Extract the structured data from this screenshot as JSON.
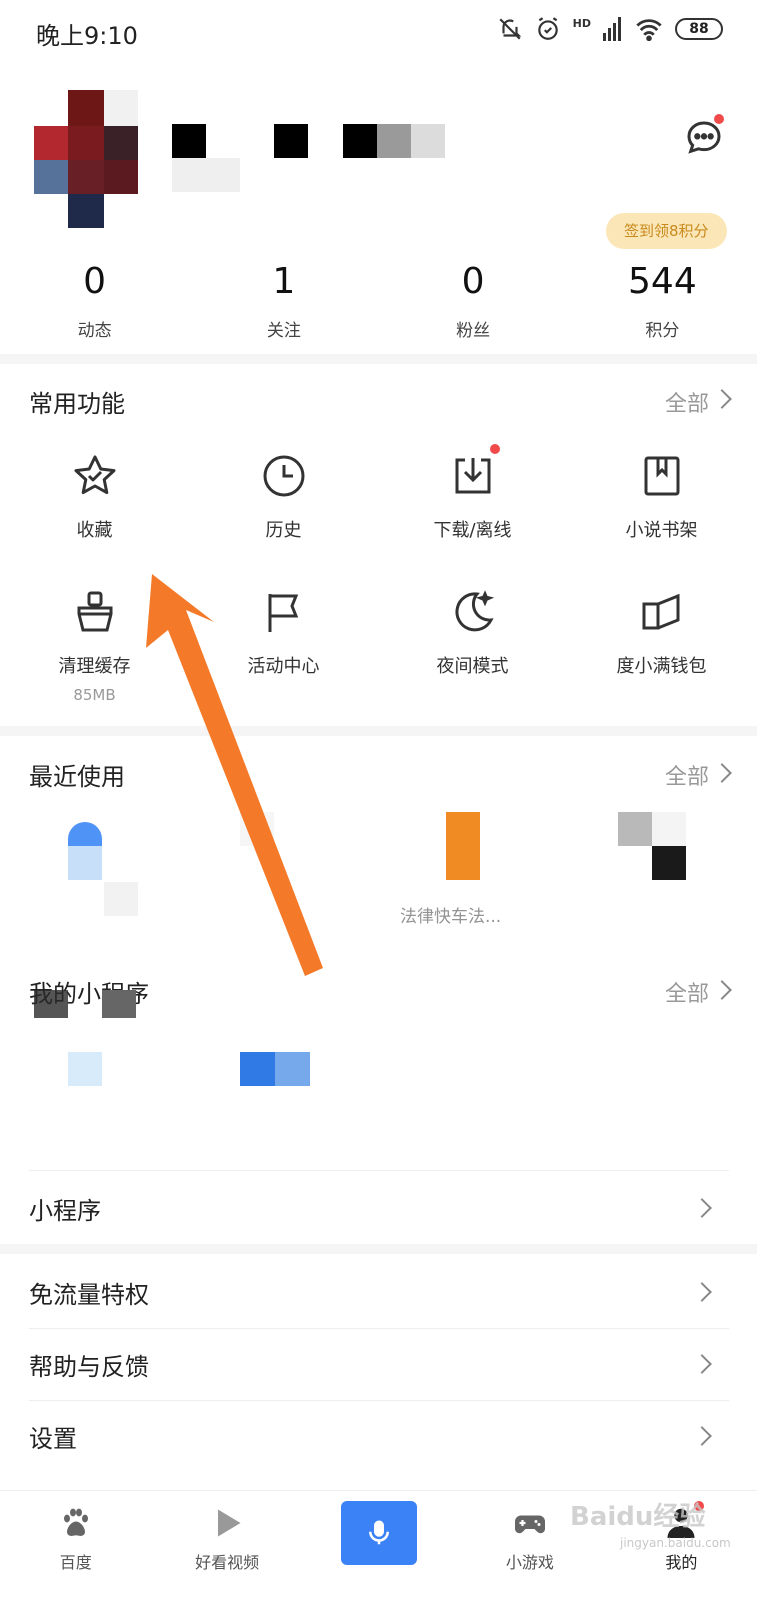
{
  "status_bar": {
    "time": "晚上9:10",
    "battery": "88",
    "network": "HD"
  },
  "profile": {
    "sign_badge": "签到领8积分",
    "stats": [
      {
        "value": "0",
        "label": "动态"
      },
      {
        "value": "1",
        "label": "关注"
      },
      {
        "value": "0",
        "label": "粉丝"
      },
      {
        "value": "544",
        "label": "积分"
      }
    ]
  },
  "common": {
    "title": "常用功能",
    "more": "全部",
    "items": [
      {
        "label": "收藏",
        "icon": "star-icon"
      },
      {
        "label": "历史",
        "icon": "clock-icon"
      },
      {
        "label": "下载/离线",
        "icon": "download-icon"
      },
      {
        "label": "小说书架",
        "icon": "book-icon"
      },
      {
        "label": "清理缓存",
        "sub": "85MB",
        "icon": "broom-icon"
      },
      {
        "label": "活动中心",
        "icon": "flag-icon"
      },
      {
        "label": "夜间模式",
        "icon": "moon-icon"
      },
      {
        "label": "度小满钱包",
        "icon": "wallet-icon"
      }
    ]
  },
  "recent": {
    "title": "最近使用",
    "more": "全部",
    "items": [
      {
        "label": ""
      },
      {
        "label": ""
      },
      {
        "label": "法律快车法..."
      },
      {
        "label": ""
      }
    ]
  },
  "mini": {
    "title": "我的小程序",
    "more": "全部"
  },
  "rows": [
    {
      "label": "小程序"
    },
    {
      "label": "免流量特权"
    },
    {
      "label": "帮助与反馈"
    },
    {
      "label": "设置"
    }
  ],
  "nav": [
    {
      "label": "百度",
      "icon": "paw-icon"
    },
    {
      "label": "好看视频",
      "icon": "play-icon"
    },
    {
      "label": "",
      "icon": "microphone-icon"
    },
    {
      "label": "小游戏",
      "icon": "gamepad-icon"
    },
    {
      "label": "我的",
      "icon": "user-icon"
    }
  ],
  "watermark": {
    "text": "Baidu经验",
    "url_text": "jingyan.baidu.com"
  },
  "colors": {
    "accent": "#3b82f6",
    "badge": "#fbe6b8",
    "badge_text": "#c98a1c",
    "arrow": "#f47a2a",
    "dot": "#f04a4a"
  }
}
